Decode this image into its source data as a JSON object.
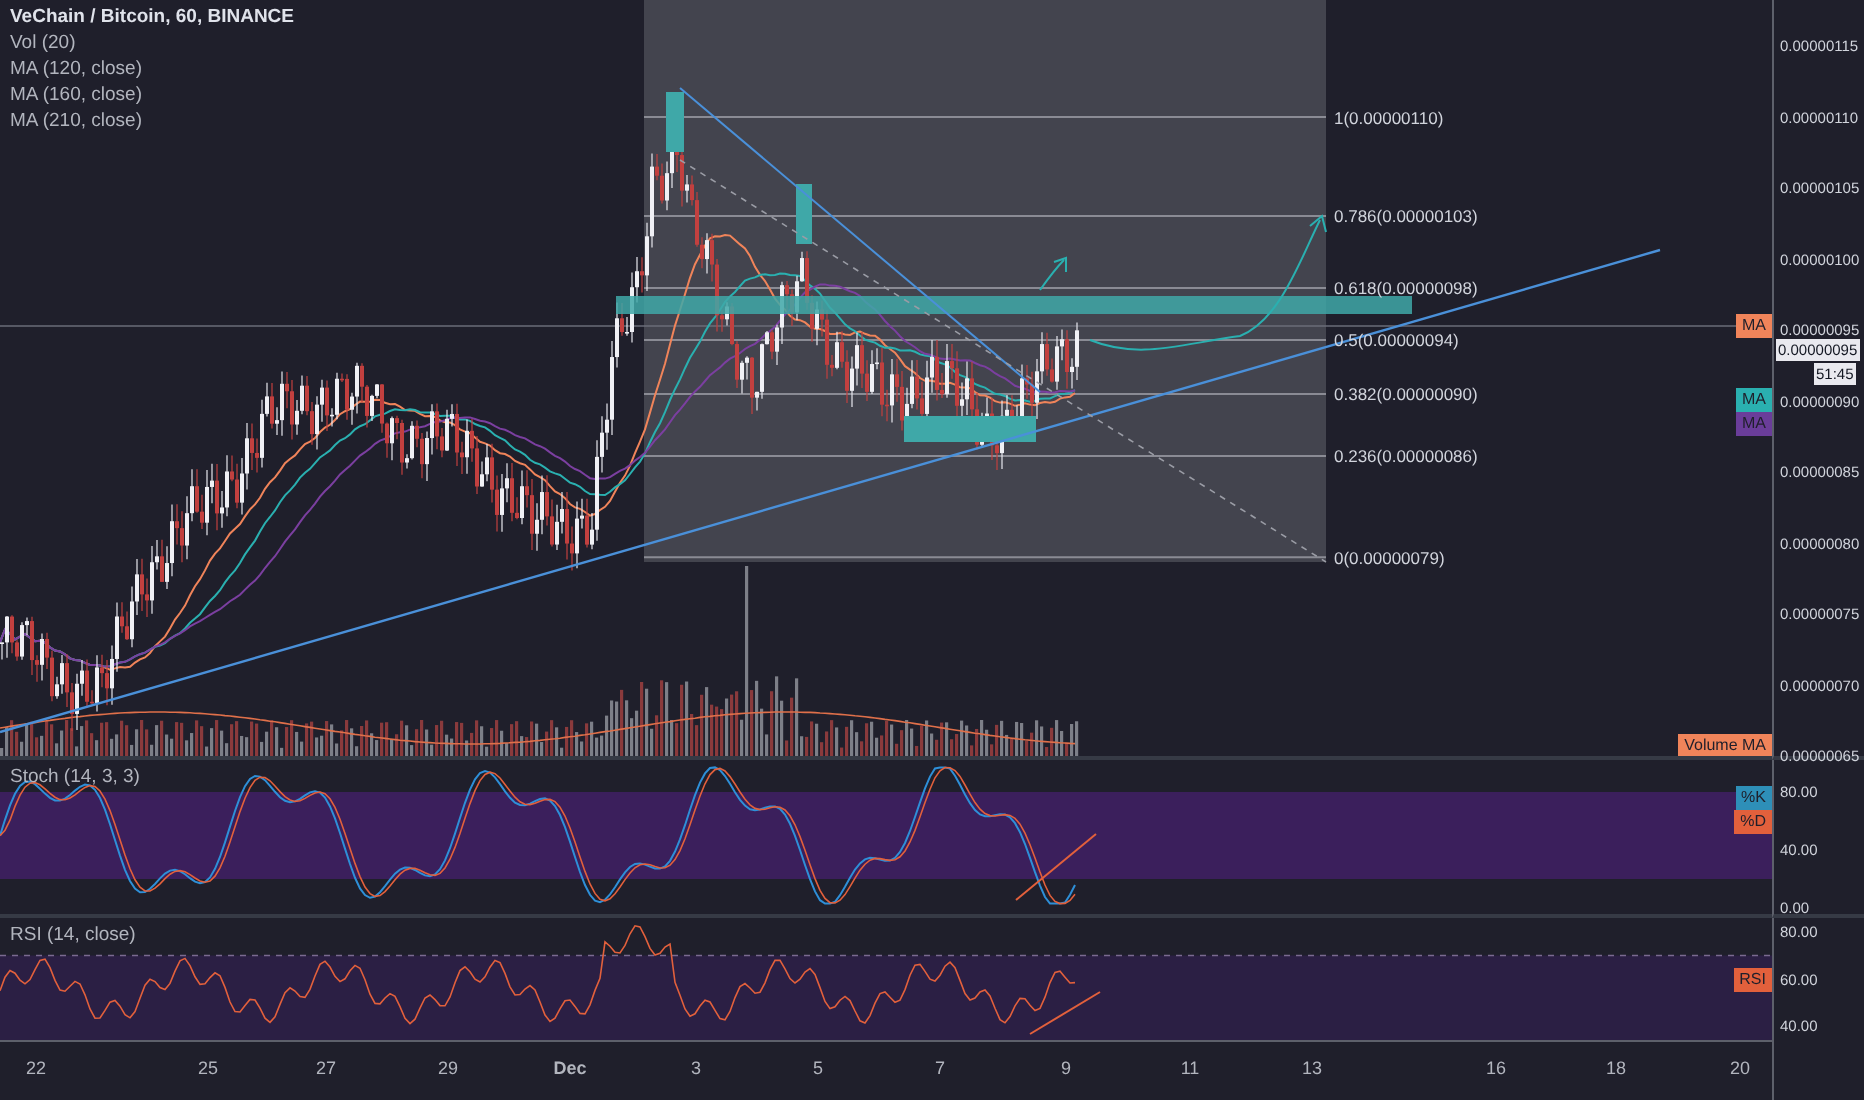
{
  "legend": {
    "title": "VeChain / Bitcoin, 60, BINANCE",
    "indicators": [
      "Vol (20)",
      "MA (120, close)",
      "MA (160, close)",
      "MA (210, close)"
    ]
  },
  "price_axis": {
    "ticks": [
      "0.00000115",
      "0.00000110",
      "0.00000105",
      "0.00000100",
      "0.00000095",
      "0.00000090",
      "0.00000085",
      "0.00000080",
      "0.00000075",
      "0.00000070",
      "0.00000065"
    ],
    "last_price": "0.00000095",
    "countdown": "51:45"
  },
  "series_tags": [
    {
      "label": "MA",
      "color": "#f0845a"
    },
    {
      "label": "MA",
      "color": "#2ab0b0"
    },
    {
      "label": "MA",
      "color": "#6a3d9a"
    },
    {
      "label": "Volume MA",
      "color": "#f0845a"
    }
  ],
  "fibonacci": {
    "levels": [
      "1(0.00000110)",
      "0.786(0.00000103)",
      "0.618(0.00000098)",
      "0.5(0.00000094)",
      "0.382(0.00000090)",
      "0.236(0.00000086)",
      "0(0.00000079)"
    ]
  },
  "stoch": {
    "title": "Stoch (14, 3, 3)",
    "ticks": [
      "80.00",
      "40.00",
      "0.00"
    ],
    "tags": [
      {
        "label": "%K",
        "color": "#2e8fb8"
      },
      {
        "label": "%D",
        "color": "#e2603c"
      }
    ]
  },
  "rsi": {
    "title": "RSI (14, close)",
    "ticks": [
      "80.00",
      "60.00",
      "40.00"
    ],
    "tags": [
      {
        "label": "RSI",
        "color": "#e2603c"
      }
    ]
  },
  "time_axis": [
    "22",
    "25",
    "27",
    "29",
    "Dec",
    "3",
    "5",
    "7",
    "9",
    "11",
    "13",
    "16",
    "18",
    "20"
  ]
}
